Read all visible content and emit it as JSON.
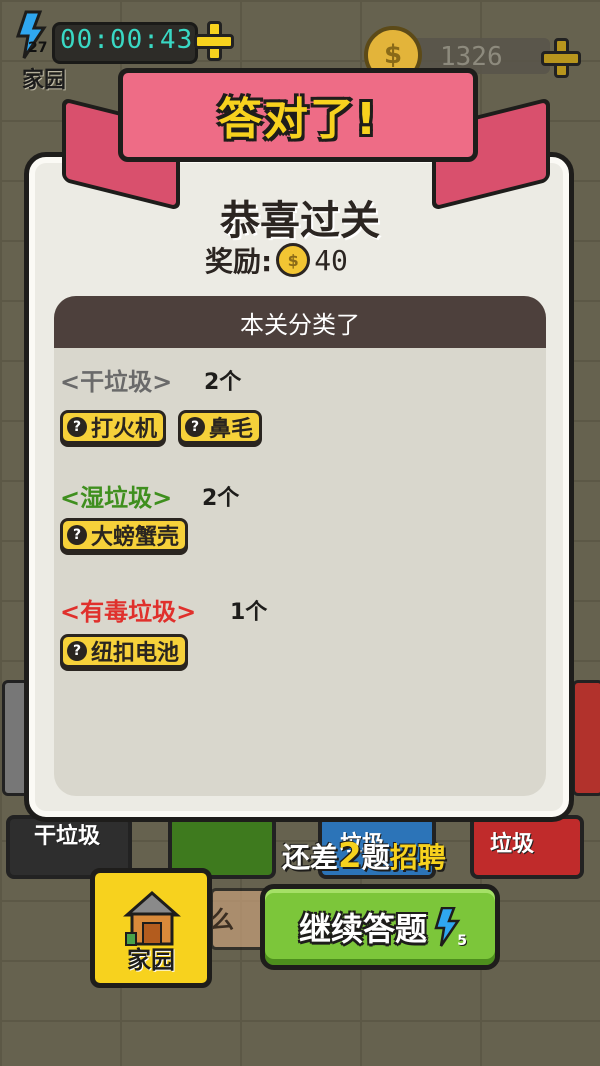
{
  "hud": {
    "energy_count": "27",
    "home_label": "家园",
    "timer": "00:00:43",
    "coins": "1326"
  },
  "background_bins": {
    "dry_label": "干垃圾",
    "blue_label": "垃圾",
    "red_label": "垃圾"
  },
  "dialog": {
    "banner_title": "答对了!",
    "heading": "恭喜过关",
    "reward_label": "奖励:",
    "reward_amount": "40",
    "panel_title": "本关分类了",
    "categories": [
      {
        "name": "<干垃圾>",
        "count": "2个",
        "color": "#6a6a6a",
        "items": [
          "打火机",
          "鼻毛"
        ]
      },
      {
        "name": "<湿垃圾>",
        "count": "2个",
        "color": "#3f8f1e",
        "items": [
          "大螃蟹壳"
        ]
      },
      {
        "name": "<有毒垃圾>",
        "count": "1个",
        "color": "#e0302c",
        "items": [
          "纽扣电池"
        ]
      }
    ]
  },
  "bottom": {
    "hint_prefix": "还差",
    "hint_number": "2",
    "hint_unit": "题",
    "hint_suffix": "招聘",
    "home_button": "家园",
    "middle_partial": "么",
    "continue_button": "继续答题",
    "continue_cost": "5"
  },
  "colors": {
    "accent_yellow": "#f7d21e",
    "ribbon_pink": "#ee6c86",
    "continue_green": "#7cc63a",
    "timer_cyan": "#39d8c4"
  }
}
